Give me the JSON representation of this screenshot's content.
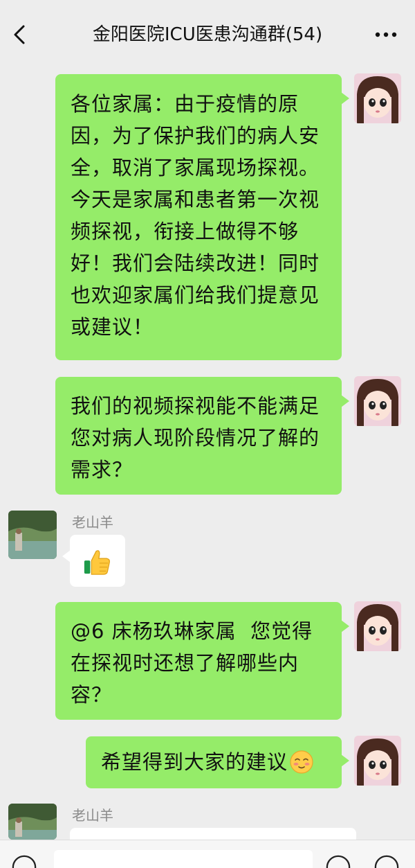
{
  "header": {
    "title": "金阳医院ICU医患沟通群(54)",
    "back_icon": "chevron-left-icon",
    "more_icon": "more-dots-icon"
  },
  "messages": [
    {
      "type": "outgoing",
      "lines": [
        "各位家属：由于疫情的原",
        "因，为了保护我们的病人安",
        "全，取消了家属现场探视。",
        "今天是家属和患者第一次视",
        "频探视，衔接上做得不够",
        "好！我们会陆续改进！同时",
        "也欢迎家属们给我们提意见",
        "或建议！"
      ]
    },
    {
      "type": "outgoing",
      "lines": [
        "我们的视频探视能不能满足",
        "您对病人现阶段情况了解的",
        "需求？"
      ]
    },
    {
      "type": "incoming",
      "sender": "老山羊",
      "content": "thumbs-up-emoji"
    },
    {
      "type": "outgoing",
      "lines": [
        "@6 床杨玖琳家属  您觉得",
        "在探视时还想了解哪些内",
        "容？"
      ]
    },
    {
      "type": "outgoing",
      "lines": [
        "希望得到大家的建议"
      ],
      "emoji": "shy-smile-emoji"
    },
    {
      "type": "incoming",
      "sender": "老山羊",
      "content": ""
    }
  ],
  "colors": {
    "background": "#ededed",
    "outgoing_bubble": "#95ec69",
    "incoming_bubble": "#ffffff",
    "sender_name": "#8a8a8a"
  }
}
